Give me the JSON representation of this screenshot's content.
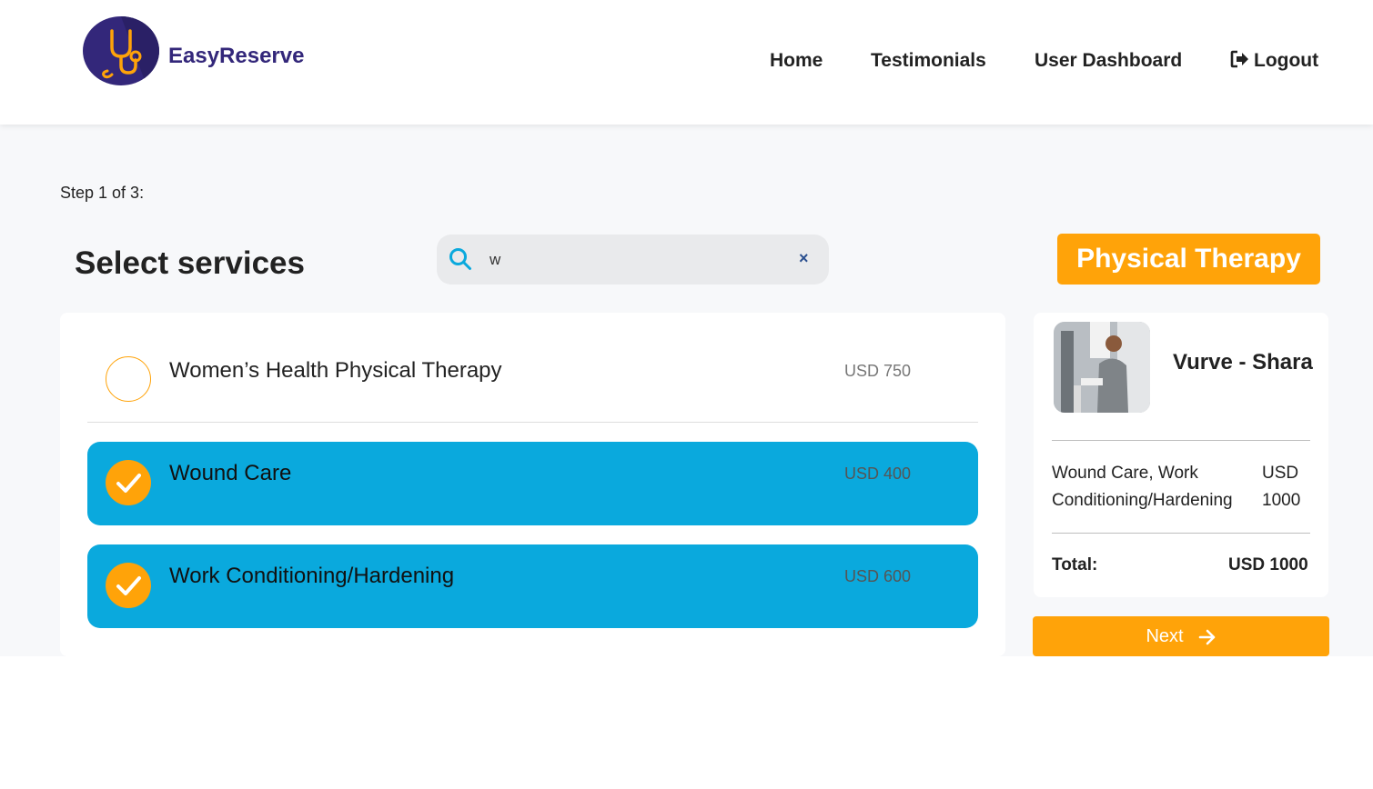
{
  "header": {
    "brand": "EasyReserve",
    "nav": {
      "home": "Home",
      "testimonials": "Testimonials",
      "dashboard": "User Dashboard",
      "logout": "Logout"
    }
  },
  "step_text": "Step 1 of 3:",
  "page_title": "Select services",
  "search": {
    "value": "w",
    "clear": "×"
  },
  "category_button": "Physical Therapy",
  "services": [
    {
      "name": "Women’s Health Physical Therapy",
      "price": "USD 750",
      "selected": false
    },
    {
      "name": "Wound Care",
      "price": "USD 400",
      "selected": true
    },
    {
      "name": "Work Conditioning/Hardening",
      "price": "USD 600",
      "selected": true
    }
  ],
  "summary": {
    "provider": "Vurve - Shara",
    "selected_services": "Wound Care, Work Conditioning/Hardening",
    "selected_amount": "USD 1000",
    "total_label": "Total:",
    "total_value": "USD 1000"
  },
  "next_button": "Next",
  "colors": {
    "brand": "#33277a",
    "accent": "#ffa309",
    "selected_row": "#0aa9dd"
  }
}
